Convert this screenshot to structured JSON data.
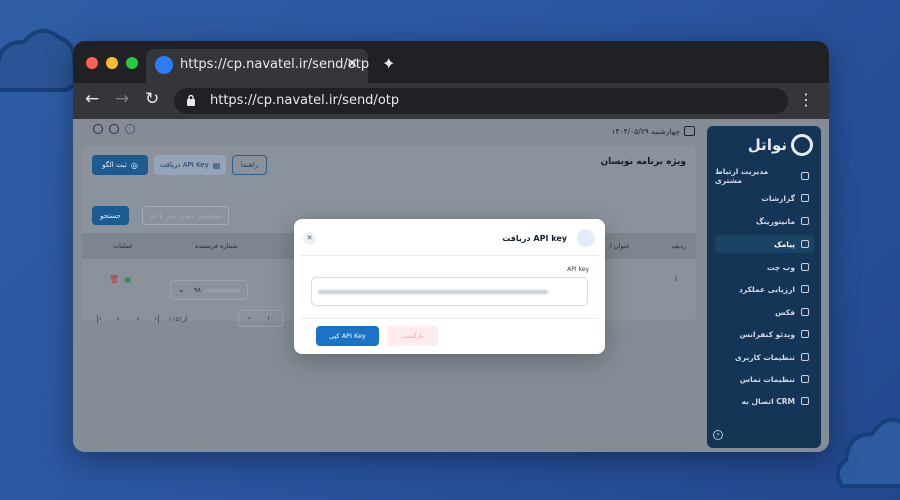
{
  "browser": {
    "tab_title": "https://cp.navatel.ir/send/otp",
    "url": "https://cp.navatel.ir/send/otp"
  },
  "app": {
    "brand": "نواتل",
    "date": "چهارشنبه ۱۴۰۴/۰۵/۲۹",
    "sidebar": {
      "items": [
        {
          "label": "مدیریت ارتباط مشتری",
          "icon": "user-icon"
        },
        {
          "label": "گزارشات",
          "icon": "shield-icon"
        },
        {
          "label": "مانیتورینگ",
          "icon": "monitor-icon"
        },
        {
          "label": "پیامک",
          "icon": "send-icon",
          "active": true
        },
        {
          "label": "وب چت",
          "icon": "chat-icon"
        },
        {
          "label": "ارزیابی عملکرد",
          "icon": "clipboard-icon"
        },
        {
          "label": "فکس",
          "icon": "fax-icon"
        },
        {
          "label": "ویدئو کنفرانس",
          "icon": "video-icon"
        },
        {
          "label": "تنظیمات کاربری",
          "icon": "user-settings-icon"
        },
        {
          "label": "تنظیمات تماس",
          "icon": "call-settings-icon"
        },
        {
          "label": "اتصال به CRM",
          "icon": "crm-icon"
        }
      ]
    },
    "main": {
      "title": "ویژه برنامه نویسان",
      "buttons": {
        "register_template": "ثبت الگو",
        "get_api_key": "دریافت API Key",
        "guide": "راهنما",
        "search": "جستجو"
      },
      "search_placeholder": "جستجوی عنوان، متن یا نام",
      "table": {
        "headers": {
          "row": "ردیف",
          "title": "عنوان ا",
          "sender": "شماره فرستنده",
          "actions": "عملیات"
        },
        "rows": [
          {
            "index": "۱",
            "sender": "۹۸"
          }
        ]
      },
      "pagination": {
        "summary": "۱از۱۵۱",
        "per_page": "۱۰"
      }
    },
    "colors": {
      "accent": "#1a73c4",
      "sidebar": "#143555"
    }
  },
  "modal": {
    "title": "دریافت API key",
    "field_label": "API key",
    "copy_button": "کپی API Key",
    "back_button": "بازگشت"
  }
}
